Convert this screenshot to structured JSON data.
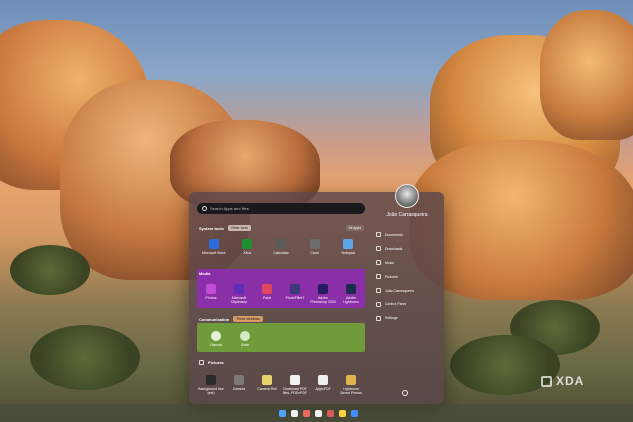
{
  "search": {
    "placeholder": "Search Apps and files"
  },
  "sections": {
    "system_tools": {
      "title": "System tools",
      "chip": "Other tools",
      "all_apps": "All apps"
    },
    "media": {
      "title": "Media"
    },
    "communication": {
      "title": "Communication",
      "chip": "Three windows"
    },
    "pictures": {
      "title": "Pictures"
    }
  },
  "system_apps": [
    {
      "label": "Microsoft Store",
      "color": "#2d6cdf"
    },
    {
      "label": "Xbox",
      "color": "#1f8f2f"
    },
    {
      "label": "Calculator",
      "color": "#5a5a5a"
    },
    {
      "label": "Clock",
      "color": "#6d6d6d"
    },
    {
      "label": "Notepad",
      "color": "#5da6e8"
    }
  ],
  "media_apps": [
    {
      "label": "Photos",
      "color": "#c24bd8"
    },
    {
      "label": "Microsoft Clipchamp",
      "color": "#5e2db8"
    },
    {
      "label": "Paint",
      "color": "#e0465f"
    },
    {
      "label": "PhotoFiltre7",
      "color": "#3d3a7c"
    },
    {
      "label": "Adobe Photoshop 2024",
      "color": "#221c5e"
    },
    {
      "label": "Adobe Lightroom",
      "color": "#1c2a4e"
    }
  ],
  "communication_apps": [
    {
      "label": "Discord",
      "color": "#e7f0d6"
    },
    {
      "label": "Slack",
      "color": "#d8e7c4"
    }
  ],
  "picture_items": [
    {
      "label": "Background blur (ext)",
      "color": "#2b2b2b"
    },
    {
      "label": "Camera",
      "color": "#7a7a7a"
    },
    {
      "label": "Camera Roll",
      "color": "#e7d36b"
    },
    {
      "label": "Download PDF files..PDEnPDF",
      "color": "#f0f0f0"
    },
    {
      "label": "JpgtoPDF",
      "color": "#f0f0f0"
    },
    {
      "label": "Lightroom Saved Photos",
      "color": "#e1b54d"
    }
  ],
  "user": {
    "name": "João Carrasqueira"
  },
  "folders": [
    {
      "label": "Documents",
      "icon": "document-icon"
    },
    {
      "label": "Downloads",
      "icon": "download-icon"
    },
    {
      "label": "Music",
      "icon": "music-icon"
    },
    {
      "label": "Pictures",
      "icon": "pictures-icon"
    },
    {
      "label": "João Carrasqueira",
      "icon": "user-folder-icon"
    },
    {
      "label": "Control Panel",
      "icon": "control-panel-icon"
    },
    {
      "label": "Settings",
      "icon": "settings-icon"
    }
  ],
  "taskbar": {
    "icons": [
      {
        "name": "start",
        "color": "#4ea3ff"
      },
      {
        "name": "search",
        "color": "#f1f1f1"
      },
      {
        "name": "taskview",
        "color": "#e86a5d"
      },
      {
        "name": "store",
        "color": "#f1f1f1"
      },
      {
        "name": "edge",
        "color": "#d65a5a"
      },
      {
        "name": "chrome",
        "color": "#ffd23f"
      },
      {
        "name": "explorer",
        "color": "#3f8fff"
      }
    ]
  },
  "watermark": "XDA"
}
